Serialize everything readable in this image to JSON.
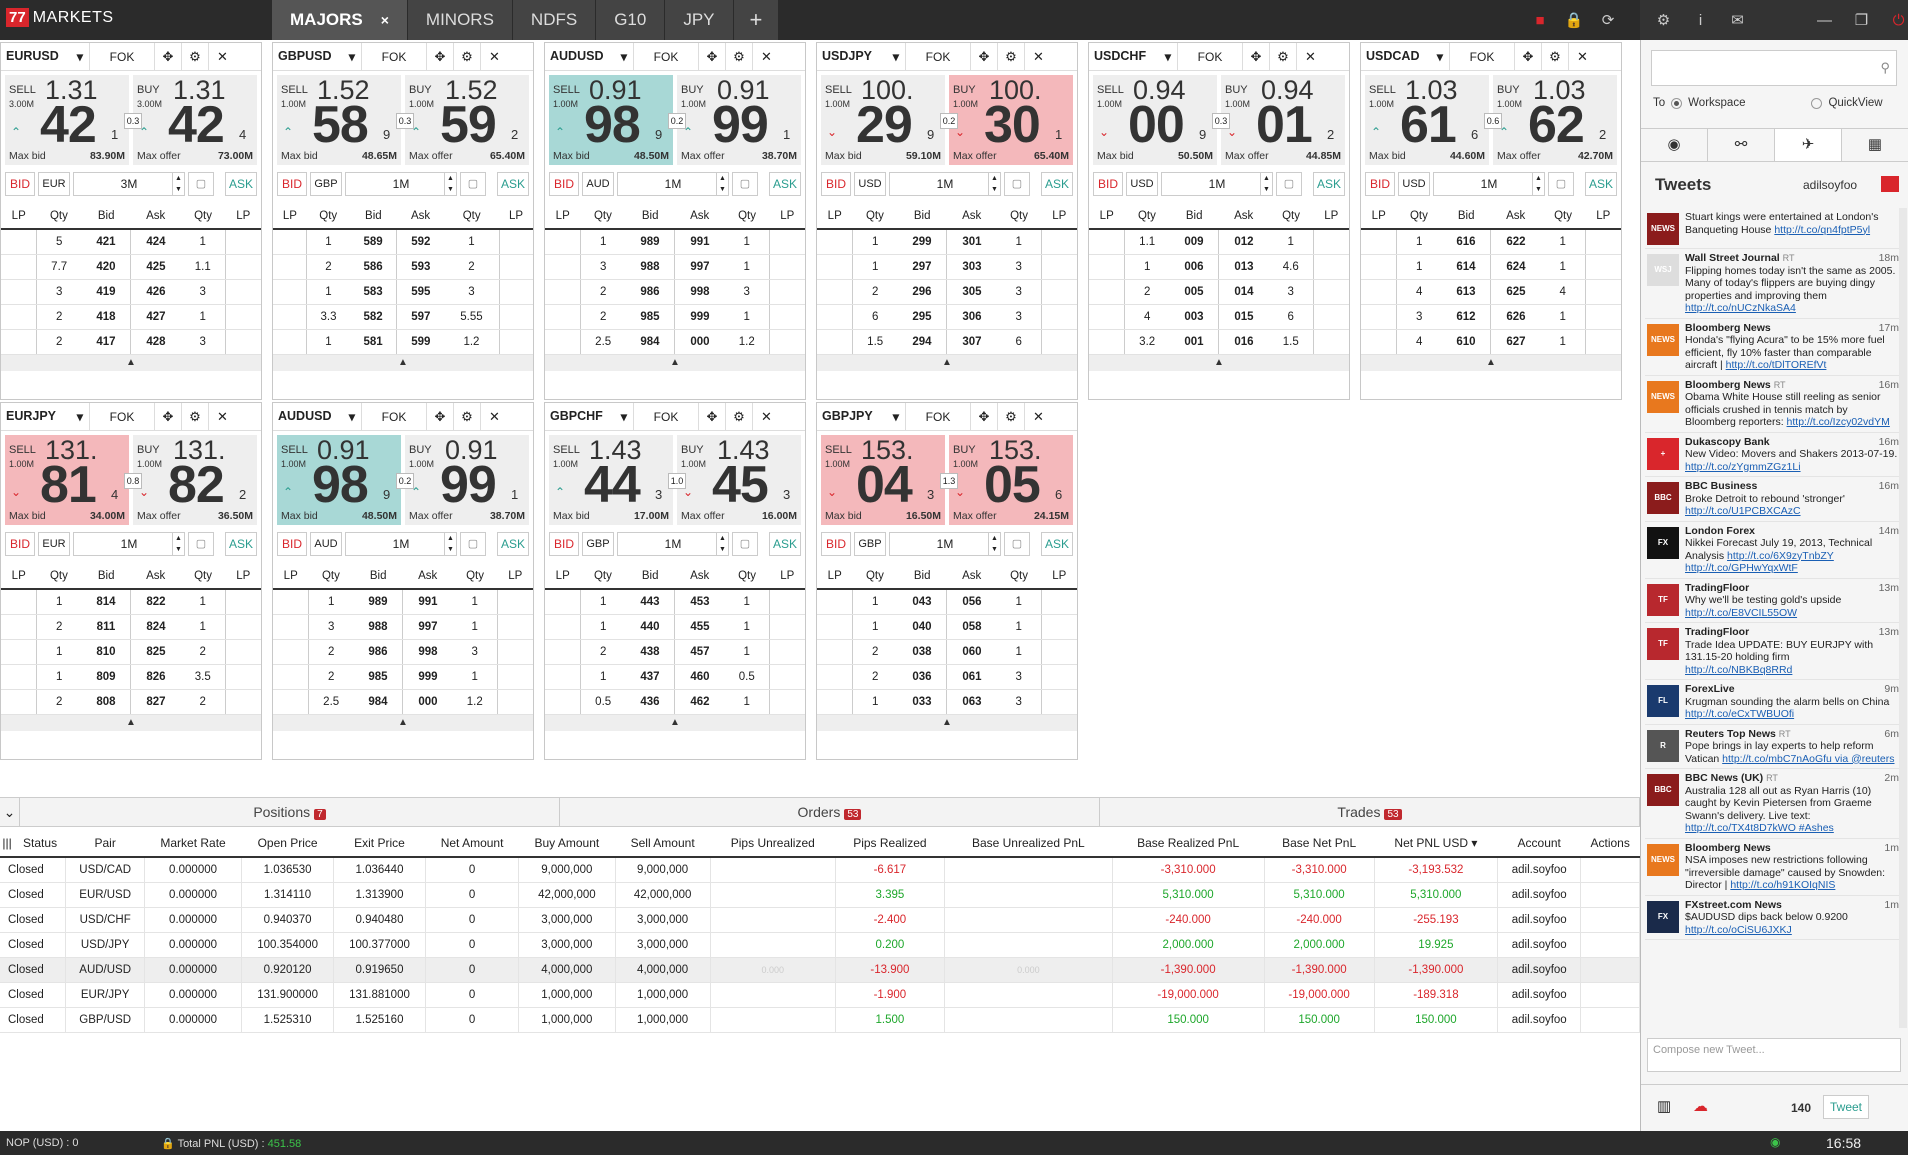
{
  "app": {
    "badge": "77",
    "title": "MARKETS"
  },
  "tabs": [
    {
      "label": "MAJORS",
      "close": "×"
    },
    {
      "label": "MINORS"
    },
    {
      "label": "NDFS"
    },
    {
      "label": "G10"
    },
    {
      "label": "JPY"
    },
    {
      "label": "+"
    }
  ],
  "top_icons": [
    "■",
    "🔒",
    "⟳",
    "⚙",
    "i",
    "✉",
    "—",
    "❐",
    "⏻"
  ],
  "panel_common": {
    "fok": "FOK",
    "bid": "BID",
    "ask": "ASK",
    "max_bid": "Max bid",
    "max_offer": "Max offer",
    "sell": "SELL",
    "buy": "BUY",
    "headers": [
      "LP",
      "Qty",
      "Bid",
      "Ask",
      "Qty",
      "LP"
    ]
  },
  "panels": [
    {
      "pair": "EURUSD",
      "sell": {
        "pre": "1.31",
        "big": "42",
        "sup": "1",
        "lot": "3.00M",
        "max": "83.90M",
        "dir": "up",
        "color": "grey"
      },
      "buy": {
        "pre": "1.31",
        "big": "42",
        "sup": "4",
        "lot": "3.00M",
        "max": "73.00M",
        "dir": "up",
        "color": "grey"
      },
      "spread": "0.3",
      "ccy": "EUR",
      "amount": "3M",
      "rows": [
        [
          "5",
          "421",
          "424",
          "1"
        ],
        [
          "7.7",
          "420",
          "425",
          "1.1"
        ],
        [
          "3",
          "419",
          "426",
          "3"
        ],
        [
          "2",
          "418",
          "427",
          "1"
        ],
        [
          "2",
          "417",
          "428",
          "3"
        ]
      ]
    },
    {
      "pair": "GBPUSD",
      "sell": {
        "pre": "1.52",
        "big": "58",
        "sup": "9",
        "lot": "1.00M",
        "max": "48.65M",
        "dir": "up",
        "color": "grey"
      },
      "buy": {
        "pre": "1.52",
        "big": "59",
        "sup": "2",
        "lot": "1.00M",
        "max": "65.40M",
        "dir": "up",
        "color": "grey"
      },
      "spread": "0.3",
      "ccy": "GBP",
      "amount": "1M",
      "rows": [
        [
          "1",
          "589",
          "592",
          "1"
        ],
        [
          "2",
          "586",
          "593",
          "2"
        ],
        [
          "1",
          "583",
          "595",
          "3"
        ],
        [
          "3.3",
          "582",
          "597",
          "5.55"
        ],
        [
          "1",
          "581",
          "599",
          "1.2"
        ]
      ]
    },
    {
      "pair": "AUDUSD",
      "sell": {
        "pre": "0.91",
        "big": "98",
        "sup": "9",
        "lot": "1.00M",
        "max": "48.50M",
        "dir": "up",
        "color": "teal"
      },
      "buy": {
        "pre": "0.91",
        "big": "99",
        "sup": "1",
        "lot": "1.00M",
        "max": "38.70M",
        "dir": "up",
        "color": "grey"
      },
      "spread": "0.2",
      "ccy": "AUD",
      "amount": "1M",
      "rows": [
        [
          "1",
          "989",
          "991",
          "1"
        ],
        [
          "3",
          "988",
          "997",
          "1"
        ],
        [
          "2",
          "986",
          "998",
          "3"
        ],
        [
          "2",
          "985",
          "999",
          "1"
        ],
        [
          "2.5",
          "984",
          "000",
          "1.2"
        ]
      ]
    },
    {
      "pair": "USDJPY",
      "sell": {
        "pre": "100.",
        "big": "29",
        "sup": "9",
        "lot": "1.00M",
        "max": "59.10M",
        "dir": "dn",
        "color": "grey"
      },
      "buy": {
        "pre": "100.",
        "big": "30",
        "sup": "1",
        "lot": "1.00M",
        "max": "65.40M",
        "dir": "dn",
        "color": "pink"
      },
      "spread": "0.2",
      "ccy": "USD",
      "amount": "1M",
      "rows": [
        [
          "1",
          "299",
          "301",
          "1"
        ],
        [
          "1",
          "297",
          "303",
          "3"
        ],
        [
          "2",
          "296",
          "305",
          "3"
        ],
        [
          "6",
          "295",
          "306",
          "3"
        ],
        [
          "1.5",
          "294",
          "307",
          "6"
        ]
      ]
    },
    {
      "pair": "USDCHF",
      "sell": {
        "pre": "0.94",
        "big": "00",
        "sup": "9",
        "lot": "1.00M",
        "max": "50.50M",
        "dir": "dn",
        "color": "grey"
      },
      "buy": {
        "pre": "0.94",
        "big": "01",
        "sup": "2",
        "lot": "1.00M",
        "max": "44.85M",
        "dir": "dn",
        "color": "grey"
      },
      "spread": "0.3",
      "ccy": "USD",
      "amount": "1M",
      "rows": [
        [
          "1.1",
          "009",
          "012",
          "1"
        ],
        [
          "1",
          "006",
          "013",
          "4.6"
        ],
        [
          "2",
          "005",
          "014",
          "3"
        ],
        [
          "4",
          "003",
          "015",
          "6"
        ],
        [
          "3.2",
          "001",
          "016",
          "1.5"
        ]
      ]
    },
    {
      "pair": "USDCAD",
      "sell": {
        "pre": "1.03",
        "big": "61",
        "sup": "6",
        "lot": "1.00M",
        "max": "44.60M",
        "dir": "up",
        "color": "grey"
      },
      "buy": {
        "pre": "1.03",
        "big": "62",
        "sup": "2",
        "lot": "1.00M",
        "max": "42.70M",
        "dir": "up",
        "color": "grey"
      },
      "spread": "0.6",
      "ccy": "USD",
      "amount": "1M",
      "rows": [
        [
          "1",
          "616",
          "622",
          "1"
        ],
        [
          "1",
          "614",
          "624",
          "1"
        ],
        [
          "4",
          "613",
          "625",
          "4"
        ],
        [
          "3",
          "612",
          "626",
          "1"
        ],
        [
          "4",
          "610",
          "627",
          "1"
        ]
      ]
    },
    {
      "pair": "EURJPY",
      "sell": {
        "pre": "131.",
        "big": "81",
        "sup": "4",
        "lot": "1.00M",
        "max": "34.00M",
        "dir": "dn",
        "color": "pink"
      },
      "buy": {
        "pre": "131.",
        "big": "82",
        "sup": "2",
        "lot": "1.00M",
        "max": "36.50M",
        "dir": "dn",
        "color": "grey"
      },
      "spread": "0.8",
      "ccy": "EUR",
      "amount": "1M",
      "rows": [
        [
          "1",
          "814",
          "822",
          "1"
        ],
        [
          "2",
          "811",
          "824",
          "1"
        ],
        [
          "1",
          "810",
          "825",
          "2"
        ],
        [
          "1",
          "809",
          "826",
          "3.5"
        ],
        [
          "2",
          "808",
          "827",
          "2"
        ]
      ]
    },
    {
      "pair": "AUDUSD",
      "sell": {
        "pre": "0.91",
        "big": "98",
        "sup": "9",
        "lot": "1.00M",
        "max": "48.50M",
        "dir": "up",
        "color": "teal"
      },
      "buy": {
        "pre": "0.91",
        "big": "99",
        "sup": "1",
        "lot": "1.00M",
        "max": "38.70M",
        "dir": "up",
        "color": "grey"
      },
      "spread": "0.2",
      "ccy": "AUD",
      "amount": "1M",
      "rows": [
        [
          "1",
          "989",
          "991",
          "1"
        ],
        [
          "3",
          "988",
          "997",
          "1"
        ],
        [
          "2",
          "986",
          "998",
          "3"
        ],
        [
          "2",
          "985",
          "999",
          "1"
        ],
        [
          "2.5",
          "984",
          "000",
          "1.2"
        ]
      ]
    },
    {
      "pair": "GBPCHF",
      "sell": {
        "pre": "1.43",
        "big": "44",
        "sup": "3",
        "lot": "1.00M",
        "max": "17.00M",
        "dir": "up",
        "color": "grey"
      },
      "buy": {
        "pre": "1.43",
        "big": "45",
        "sup": "3",
        "lot": "1.00M",
        "max": "16.00M",
        "dir": "dn",
        "color": "grey"
      },
      "spread": "1.0",
      "ccy": "GBP",
      "amount": "1M",
      "rows": [
        [
          "1",
          "443",
          "453",
          "1"
        ],
        [
          "1",
          "440",
          "455",
          "1"
        ],
        [
          "2",
          "438",
          "457",
          "1"
        ],
        [
          "1",
          "437",
          "460",
          "0.5"
        ],
        [
          "0.5",
          "436",
          "462",
          "1"
        ]
      ]
    },
    {
      "pair": "GBPJPY",
      "sell": {
        "pre": "153.",
        "big": "04",
        "sup": "3",
        "lot": "1.00M",
        "max": "16.50M",
        "dir": "dn",
        "color": "pink"
      },
      "buy": {
        "pre": "153.",
        "big": "05",
        "sup": "6",
        "lot": "1.00M",
        "max": "24.15M",
        "dir": "dn",
        "color": "pink"
      },
      "spread": "1.3",
      "ccy": "GBP",
      "amount": "1M",
      "rows": [
        [
          "1",
          "043",
          "056",
          "1"
        ],
        [
          "1",
          "040",
          "058",
          "1"
        ],
        [
          "2",
          "038",
          "060",
          "1"
        ],
        [
          "2",
          "036",
          "061",
          "3"
        ],
        [
          "1",
          "033",
          "063",
          "3"
        ]
      ]
    }
  ],
  "positions_tabs": [
    {
      "label": "Positions",
      "count": "7"
    },
    {
      "label": "Orders",
      "count": "53"
    },
    {
      "label": "Trades",
      "count": "53"
    }
  ],
  "positions_headers": [
    "Status",
    "Pair",
    "Market Rate",
    "Open Price",
    "Exit Price",
    "Net Amount",
    "Buy Amount",
    "Sell Amount",
    "Pips Unrealized",
    "Pips Realized",
    "Base Unrealized PnL",
    "Base Realized PnL",
    "Base Net PnL",
    "Net PNL  USD ▾",
    "Account",
    "Actions"
  ],
  "positions": [
    [
      "Closed",
      "USD/CAD",
      "0.000000",
      "1.036530",
      "1.036440",
      "0",
      "9,000,000",
      "9,000,000",
      "",
      "-6.617",
      "",
      "-3,310.000",
      "-3,310.000",
      "-3,193.532",
      "adil.soyfoo",
      ""
    ],
    [
      "Closed",
      "EUR/USD",
      "0.000000",
      "1.314110",
      "1.313900",
      "0",
      "42,000,000",
      "42,000,000",
      "",
      "3.395",
      "",
      "5,310.000",
      "5,310.000",
      "5,310.000",
      "adil.soyfoo",
      ""
    ],
    [
      "Closed",
      "USD/CHF",
      "0.000000",
      "0.940370",
      "0.940480",
      "0",
      "3,000,000",
      "3,000,000",
      "",
      "-2.400",
      "",
      "-240.000",
      "-240.000",
      "-255.193",
      "adil.soyfoo",
      ""
    ],
    [
      "Closed",
      "USD/JPY",
      "0.000000",
      "100.354000",
      "100.377000",
      "0",
      "3,000,000",
      "3,000,000",
      "",
      "0.200",
      "",
      "2,000.000",
      "2,000.000",
      "19.925",
      "adil.soyfoo",
      ""
    ],
    [
      "Closed",
      "AUD/USD",
      "0.000000",
      "0.920120",
      "0.919650",
      "0",
      "4,000,000",
      "4,000,000",
      "0.000",
      "-13.900",
      "0.000",
      "-1,390.000",
      "-1,390.000",
      "-1,390.000",
      "adil.soyfoo",
      ""
    ],
    [
      "Closed",
      "EUR/JPY",
      "0.000000",
      "131.900000",
      "131.881000",
      "0",
      "1,000,000",
      "1,000,000",
      "",
      "-1.900",
      "",
      "-19,000.000",
      "-19,000.000",
      "-189.318",
      "adil.soyfoo",
      ""
    ],
    [
      "Closed",
      "GBP/USD",
      "0.000000",
      "1.525310",
      "1.525160",
      "0",
      "1,000,000",
      "1,000,000",
      "",
      "1.500",
      "",
      "150.000",
      "150.000",
      "150.000",
      "adil.soyfoo",
      ""
    ]
  ],
  "status": {
    "nop": "NOP (USD) : 0",
    "tpnl_label": "Total PNL (USD) :",
    "tpnl_value": "451.58",
    "clock": "16:58"
  },
  "sidebar": {
    "to_label": "To",
    "workspace": "Workspace",
    "quickview": "QuickView",
    "tweets_title": "Tweets",
    "user": "adilsoyfoo",
    "compose_placeholder": "Compose new Tweet...",
    "count": "140",
    "tweet_btn": "Tweet",
    "tweets": [
      {
        "name": "",
        "time": "",
        "text": "Stuart kings were entertained at London's Banqueting House ",
        "link": "http://t.co/qn4fptP5yl",
        "av": "#8b1c1c",
        "avtxt": "NEWS"
      },
      {
        "name": "Wall Street Journal",
        "rt": "RT",
        "time": "18m",
        "text": "Flipping homes today isn't the same as 2005. Many of today's flippers are buying dingy properties and improving them ",
        "link": "http://t.co/nUCzNkaSA4",
        "av": "#ddd",
        "avtxt": "WSJ"
      },
      {
        "name": "Bloomberg News",
        "time": "17m",
        "text": "Honda's \"flying Acura\" to be 15% more fuel efficient, fly 10% faster than comparable aircraft | ",
        "link": "http://t.co/tDlTOREfVt",
        "av": "#e8781e",
        "avtxt": "NEWS"
      },
      {
        "name": "Bloomberg News",
        "rt": "RT",
        "time": "16m",
        "text": "Obama White House still reeling as senior officials crushed in tennis match by Bloomberg reporters: ",
        "link": "http://t.co/Izcy02vdYM",
        "av": "#e8781e",
        "avtxt": "NEWS"
      },
      {
        "name": "Dukascopy Bank",
        "time": "16m",
        "text": "New Video: Movers and Shakers 2013-07-19. ",
        "link": "http://t.co/zYgmmZGz1Li",
        "av": "#d9262c",
        "avtxt": "+"
      },
      {
        "name": "BBC Business",
        "time": "16m",
        "text": "Broke Detroit to rebound 'stronger' ",
        "link": "http://t.co/U1PCBXCAzC",
        "av": "#8b1c1c",
        "avtxt": "BBC"
      },
      {
        "name": "London Forex",
        "time": "14m",
        "text": "Nikkei Forecast July 19, 2013, Technical Analysis ",
        "link": "http://t.co/6X9zyTnbZY http://t.co/GPHwYqxWtF",
        "av": "#111",
        "avtxt": "FX"
      },
      {
        "name": "TradingFloor",
        "time": "13m",
        "text": "Why we'll be testing gold's upside ",
        "link": "http://t.co/E8VCIL55OW",
        "av": "#b8282e",
        "avtxt": "TF"
      },
      {
        "name": "TradingFloor",
        "time": "13m",
        "text": "Trade Idea UPDATE: BUY EURJPY with 131.15-20 holding firm ",
        "link": "http://t.co/NBKBq8RRd",
        "av": "#b8282e",
        "avtxt": "TF"
      },
      {
        "name": "ForexLive",
        "time": "9m",
        "text": "Krugman sounding the alarm bells on China ",
        "link": "http://t.co/eCxTWBUOfi",
        "av": "#1a3a6e",
        "avtxt": "FL"
      },
      {
        "name": "Reuters Top News",
        "rt": "RT",
        "time": "6m",
        "text": "Pope brings in lay experts to help reform Vatican ",
        "link": "http://t.co/mbC7nAoGfu via @reuters",
        "av": "#555",
        "avtxt": "R"
      },
      {
        "name": "BBC News (UK)",
        "rt": "RT",
        "time": "2m",
        "text": "Australia 128 all out as Ryan Harris (10) caught by Kevin Pietersen from Graeme Swann's delivery. Live text: ",
        "link": "http://t.co/TX4t8D7kWO #Ashes",
        "av": "#8b1c1c",
        "avtxt": "BBC"
      },
      {
        "name": "Bloomberg News",
        "time": "1m",
        "text": "NSA imposes new restrictions following \"irreversible damage\" caused by Snowden: Director | ",
        "link": "http://t.co/h91KOIqNIS",
        "av": "#e8781e",
        "avtxt": "NEWS"
      },
      {
        "name": "FXstreet.com News",
        "time": "1m",
        "text": "$AUDUSD dips back below 0.9200 ",
        "link": "http://t.co/oCiSU6JXKJ",
        "av": "#1a2a4a",
        "avtxt": "FX"
      }
    ]
  }
}
